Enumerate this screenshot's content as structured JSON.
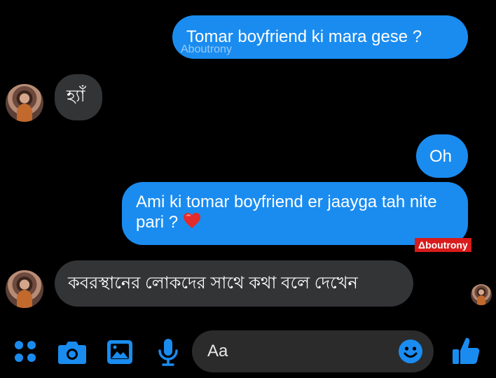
{
  "messages": [
    {
      "side": "out",
      "text": "Tomar boyfriend ki mara gese ?"
    },
    {
      "side": "in",
      "text": "হ্যাঁ"
    },
    {
      "side": "out",
      "text": "Oh"
    },
    {
      "side": "out",
      "text": "Ami ki tomar boyfriend er jaayga tah nite pari ? "
    },
    {
      "side": "in",
      "text": "কবরস্থানের লোকদের সাথে কথা বলে দেখেন"
    }
  ],
  "watermarks": {
    "first": "Aboutrony",
    "second": "Δboutrony"
  },
  "composer": {
    "placeholder": "Aa"
  },
  "colors": {
    "outgoing": "#1a8cf0",
    "incoming": "#333436",
    "accent": "#1a8cf0",
    "tag": "#d81b1b"
  },
  "icons": [
    "apps-icon",
    "camera-icon",
    "gallery-icon",
    "microphone-icon",
    "emoji-icon",
    "thumbs-up-icon",
    "heart-icon"
  ]
}
